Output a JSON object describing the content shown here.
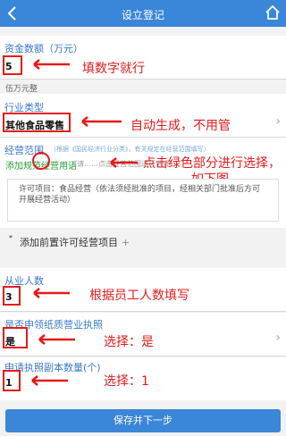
{
  "header": {
    "title": "设立登记",
    "back_icon": "chevron-left-icon",
    "home_icon": "home-icon"
  },
  "capital": {
    "label": "资金数额（万元）",
    "value": "5",
    "sub": "伍万元整",
    "note": "填数字就行"
  },
  "industry": {
    "label": "行业类型",
    "value": "其他食品零售",
    "note": "自动生成，不用管"
  },
  "scope": {
    "label": "经营范围",
    "label_hint": "（根据《国民经济行业分类》，有关规定在经营范围填写）",
    "link": "添加规范经营用语",
    "link_hint": "（请……点击经营范围进行选择）",
    "text": "许可项目：食品经营（依法须经批准的项目，经相关部门批准后方可开展经营活动）",
    "note_line1": "点击绿色部分进行选择，",
    "note_line2": "如下图"
  },
  "permit": {
    "star": "*",
    "label": "添加前置许可经营项目",
    "plus": "+"
  },
  "employees": {
    "label": "从业人数",
    "value": "3",
    "note": "根据员工人数填写"
  },
  "paper_license": {
    "label": "是否申领纸质营业执照",
    "value": "是",
    "note": "选择：是"
  },
  "copies": {
    "label": "申请执照副本数量(个)",
    "value": "1",
    "note": "选择：1"
  },
  "submit": {
    "label": "保存并下一步"
  },
  "colors": {
    "header": "#3a86d8",
    "annotation": "#e31b1b",
    "link_green": "#2a9d3a",
    "label_blue": "#3a78c8"
  }
}
